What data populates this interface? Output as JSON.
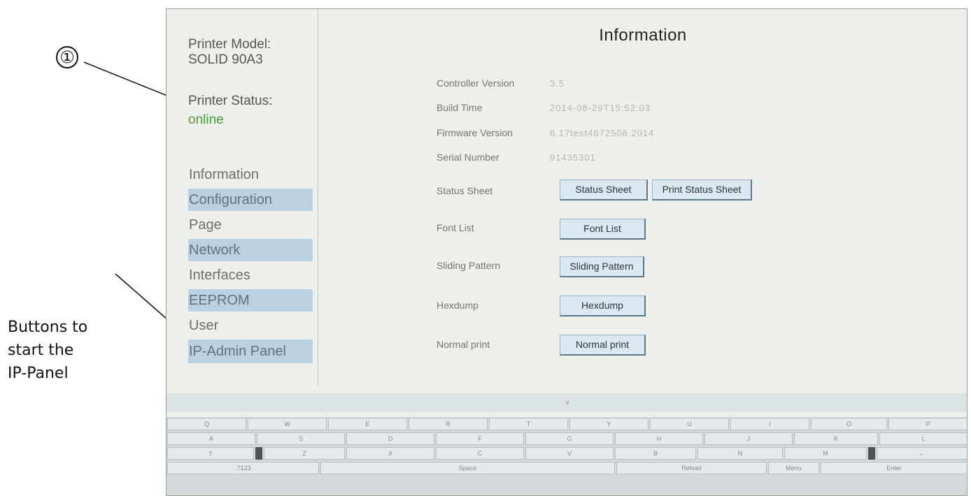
{
  "annotations": {
    "marker": "①",
    "caption_lines": [
      "Buttons to",
      "start the",
      "IP-Panel"
    ]
  },
  "sidebar": {
    "printer_model_label": "Printer Model:",
    "printer_model_value": "SOLID 90A3",
    "printer_status_label": "Printer Status:",
    "printer_status_value": "online",
    "status_color": "#4d9a3a",
    "highlight_color": "#b9d1e3",
    "nav": [
      "Information",
      "Configuration",
      "Page",
      "Network",
      "Interfaces",
      "EEPROM",
      "User",
      "IP-Admin Panel"
    ]
  },
  "main": {
    "title": "Information",
    "info": [
      {
        "label": "Controller Version",
        "value": "3.5"
      },
      {
        "label": "Build Time",
        "value": "2014-08-29T15:52:03"
      },
      {
        "label": "Firmware Version",
        "value": "6.17test4672508.2014"
      },
      {
        "label": "Serial Number",
        "value": "91435301"
      }
    ],
    "actions": [
      {
        "label": "Status Sheet",
        "buttons": [
          "Status Sheet",
          "Print Status Sheet"
        ]
      },
      {
        "label": "Font List",
        "buttons": [
          "Font List"
        ]
      },
      {
        "label": "Sliding Pattern",
        "buttons": [
          "Sliding Pattern"
        ]
      },
      {
        "label": "Hexdump",
        "buttons": [
          "Hexdump"
        ]
      },
      {
        "label": "Normal print",
        "buttons": [
          "Normal print"
        ]
      }
    ]
  },
  "keyboard": {
    "collapse_label": "v",
    "row1": [
      "Q",
      "W",
      "E",
      "R",
      "T",
      "Y",
      "U",
      "I",
      "O",
      "P"
    ],
    "row2": [
      "A",
      "S",
      "D",
      "F",
      "G",
      "H",
      "J",
      "K",
      "L"
    ],
    "row3": [
      "⇧",
      "Z",
      "X",
      "C",
      "V",
      "B",
      "N",
      "M",
      "←"
    ],
    "row4": [
      ".?123",
      "Space",
      "Reload",
      "Menu",
      "Enter"
    ]
  }
}
